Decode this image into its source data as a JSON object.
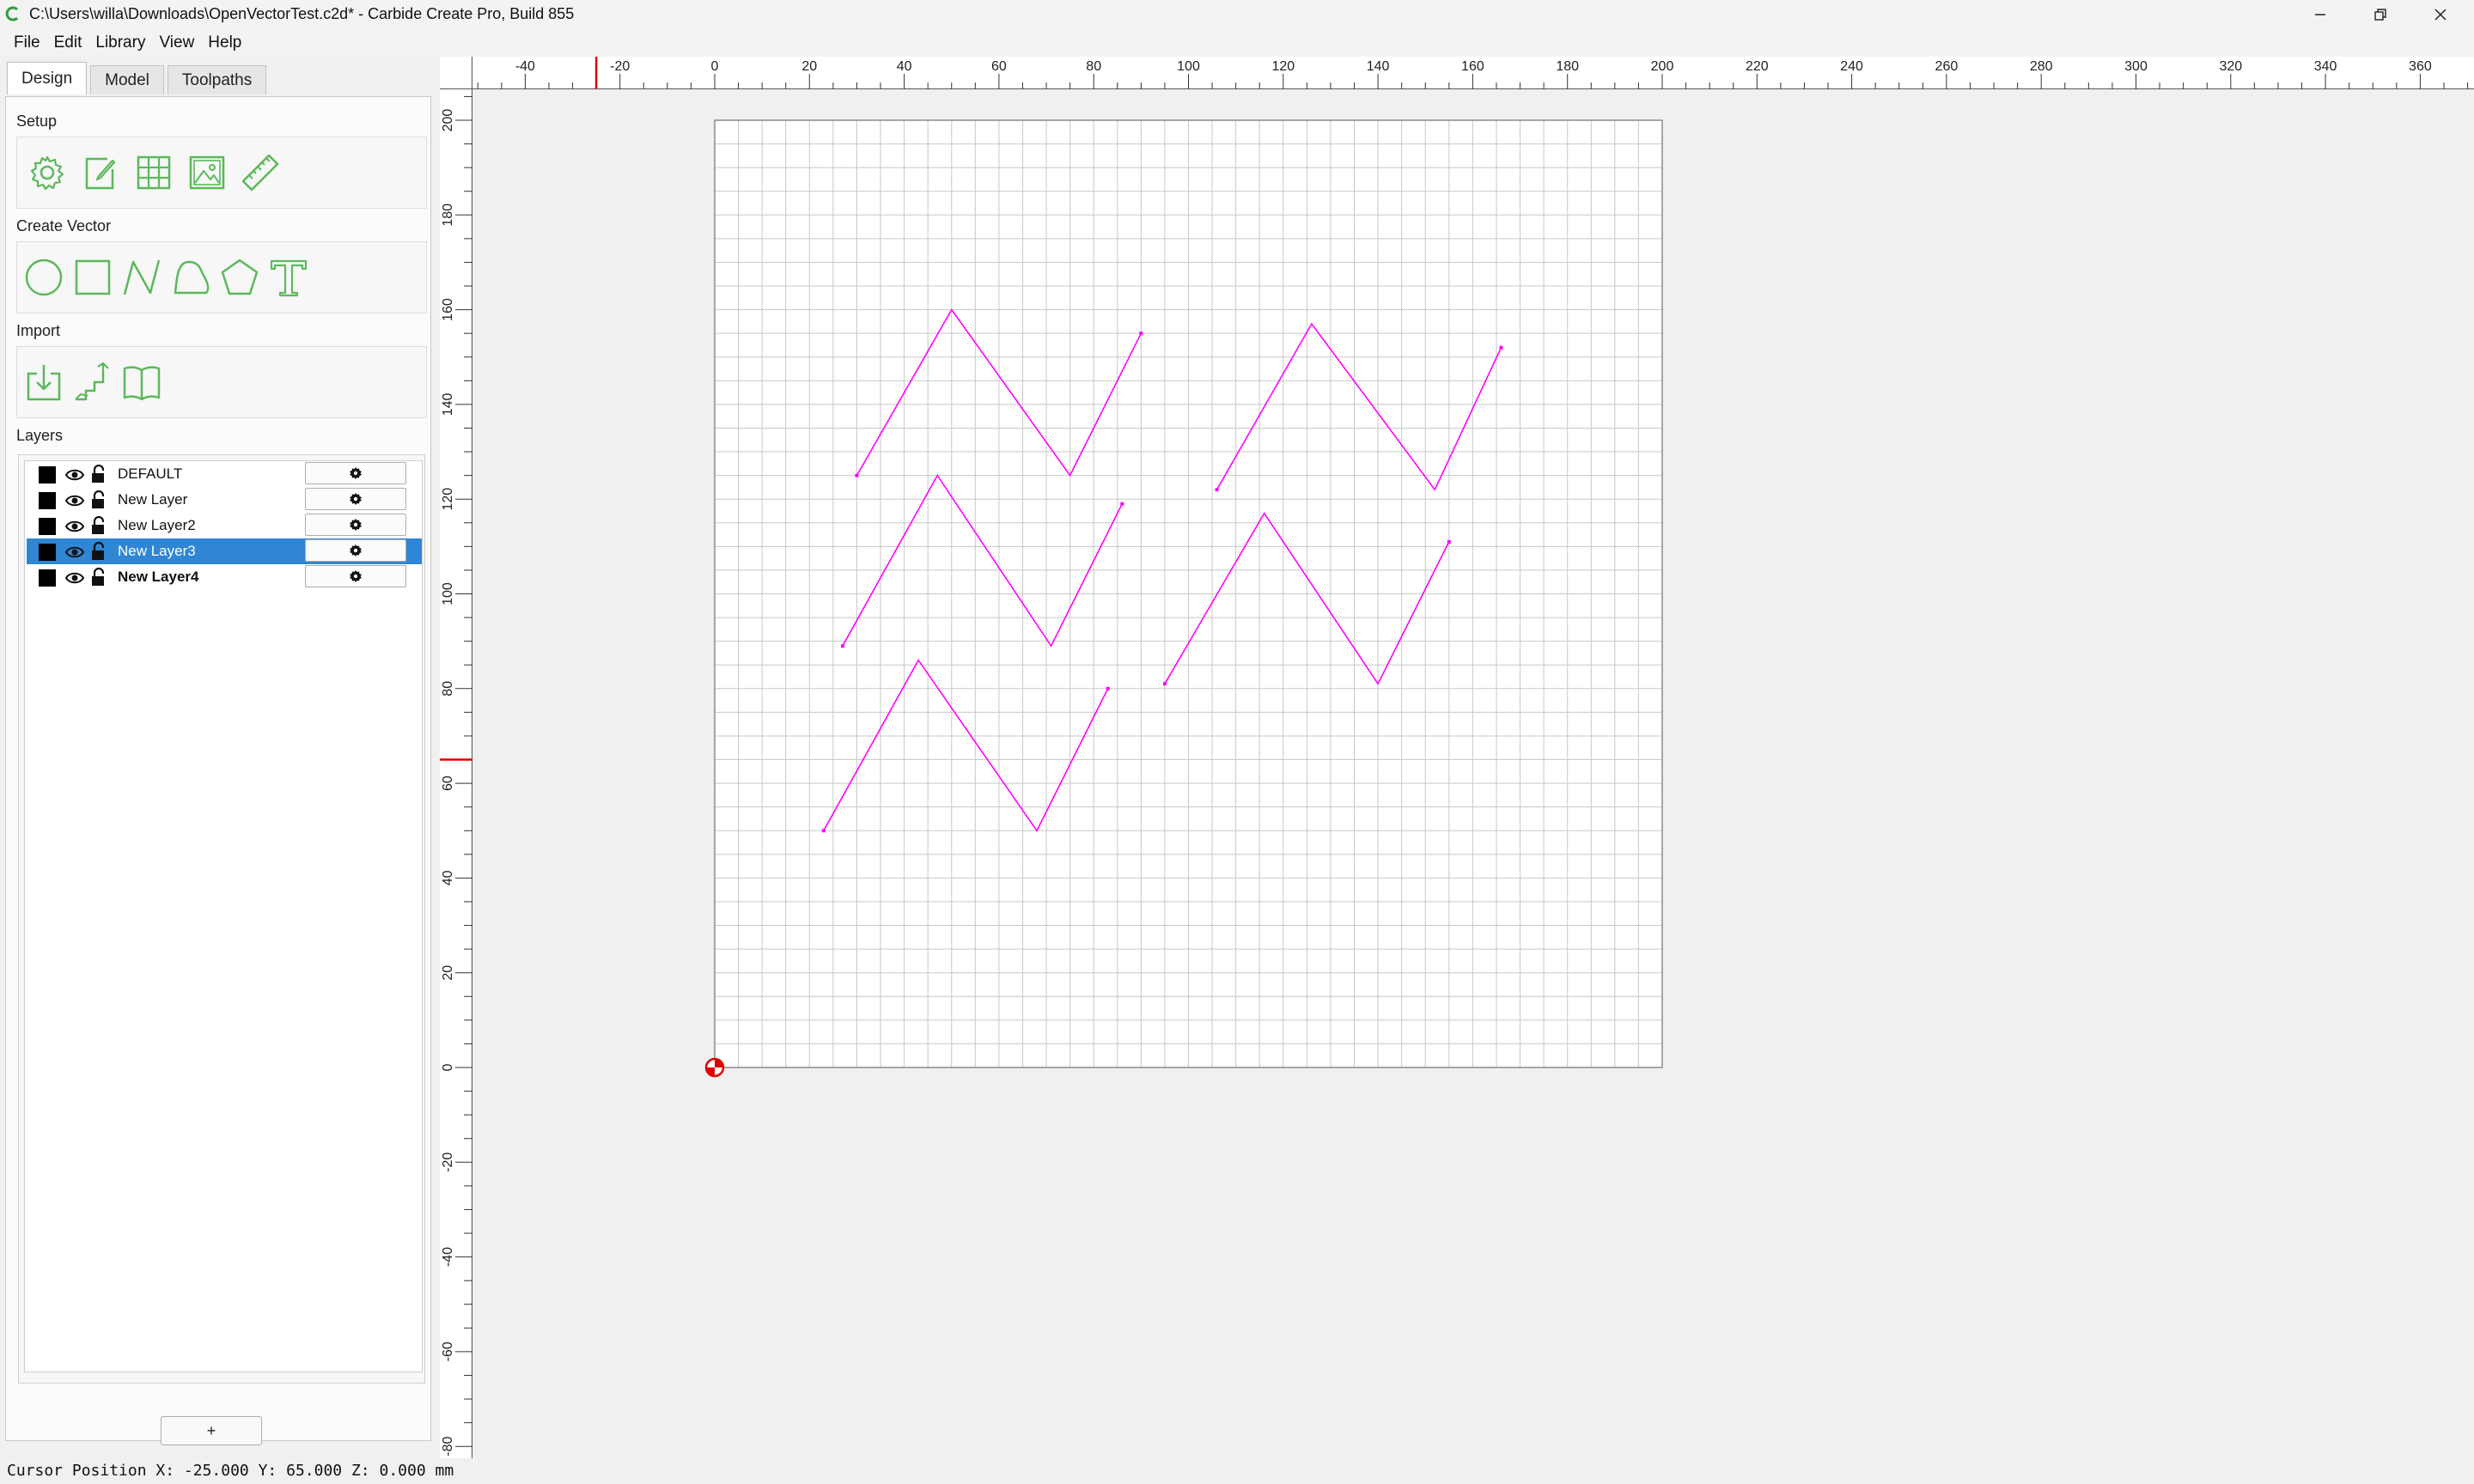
{
  "window": {
    "title": "C:\\Users\\willa\\Downloads\\OpenVectorTest.c2d* - Carbide Create Pro, Build 855",
    "app_icon": "carbide-c-icon",
    "controls": [
      "minimize-icon",
      "restore-icon",
      "close-icon"
    ]
  },
  "menu": [
    "File",
    "Edit",
    "Library",
    "View",
    "Help"
  ],
  "tabs": [
    {
      "label": "Design",
      "active": true
    },
    {
      "label": "Model",
      "active": false
    },
    {
      "label": "Toolpaths",
      "active": false
    }
  ],
  "sections": {
    "setup": "Setup",
    "create_vector": "Create Vector",
    "import": "Import",
    "layers": "Layers"
  },
  "tools": {
    "setup": [
      "gear-icon",
      "edit-document-icon",
      "grid-icon",
      "image-icon",
      "ruler-icon"
    ],
    "create_vector": [
      "circle-icon",
      "rectangle-icon",
      "polyline-icon",
      "curve-icon",
      "polygon-icon",
      "text-icon"
    ],
    "import": [
      "import-file-icon",
      "import-path-icon",
      "library-book-icon"
    ]
  },
  "layers": [
    {
      "name": "DEFAULT",
      "selected": false,
      "bold": false
    },
    {
      "name": "New Layer",
      "selected": false,
      "bold": false
    },
    {
      "name": "New Layer2",
      "selected": false,
      "bold": false
    },
    {
      "name": "New Layer3",
      "selected": true,
      "bold": false
    },
    {
      "name": "New Layer4",
      "selected": false,
      "bold": true
    }
  ],
  "add_layer_label": "+",
  "ruler": {
    "x_ticks": [
      "-40",
      "-20",
      "0",
      "20",
      "40",
      "60",
      "80",
      "100",
      "120",
      "140",
      "160",
      "180",
      "200",
      "220",
      "240",
      "260",
      "280",
      "300",
      "320",
      "340",
      "360"
    ],
    "y_ticks": [
      "200",
      "180",
      "160",
      "140",
      "120",
      "100",
      "80",
      "60",
      "40",
      "20",
      "0",
      "-20",
      "-40",
      "-60",
      "-80"
    ]
  },
  "stock": {
    "width_mm": 200,
    "height_mm": 200,
    "grid_mm": 5
  },
  "vectors": {
    "color": "#ff00ff",
    "paths": [
      [
        [
          30,
          125
        ],
        [
          50,
          160
        ],
        [
          75,
          125
        ],
        [
          90,
          155
        ]
      ],
      [
        [
          106,
          122
        ],
        [
          126,
          157
        ],
        [
          152,
          122
        ],
        [
          166,
          152
        ]
      ],
      [
        [
          27,
          89
        ],
        [
          47,
          125
        ],
        [
          71,
          89
        ],
        [
          86,
          119
        ]
      ],
      [
        [
          95,
          81
        ],
        [
          116,
          117
        ],
        [
          140,
          81
        ],
        [
          155,
          111
        ]
      ],
      [
        [
          23,
          50
        ],
        [
          43,
          86
        ],
        [
          68,
          50
        ],
        [
          83,
          80
        ]
      ]
    ]
  },
  "cursor": {
    "x_mm": -25,
    "y_mm": 65
  },
  "accent_color": "#2f86d4",
  "tool_color": "#5cb85c",
  "status": "Cursor Position X: -25.000 Y: 65.000 Z: 0.000 mm"
}
